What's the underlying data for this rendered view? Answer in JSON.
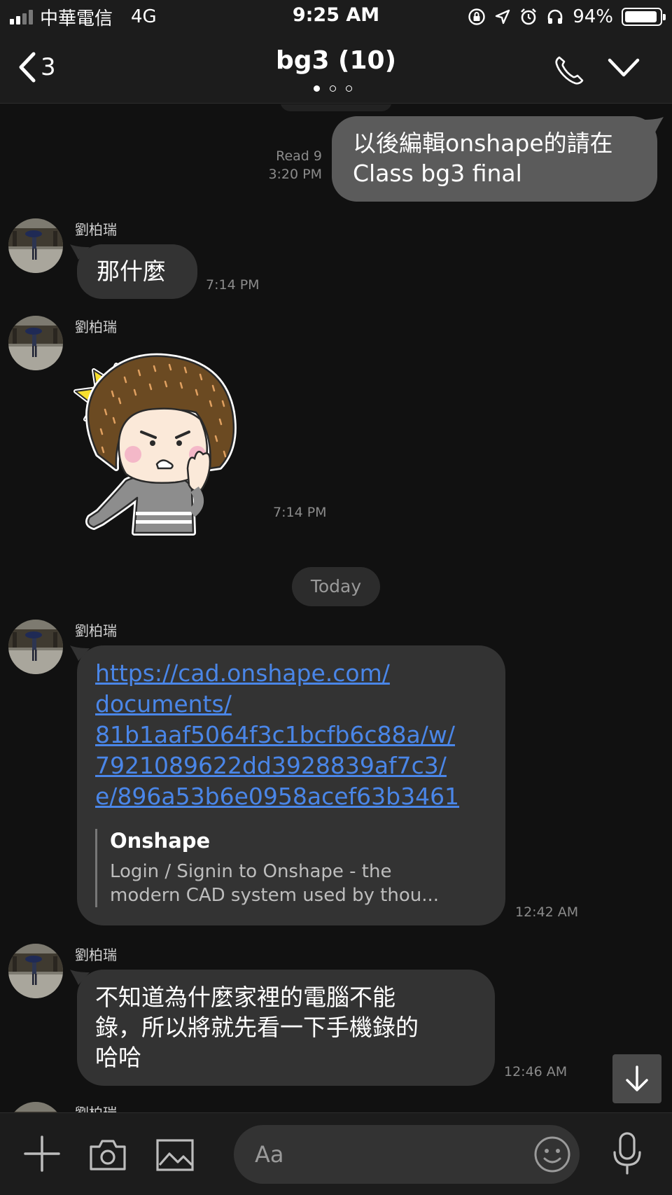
{
  "status_bar": {
    "carrier": "中華電信",
    "network": "4G",
    "time": "9:25 AM",
    "battery": "94%",
    "battery_level": 0.94
  },
  "header": {
    "back_count": "3",
    "title": "bg3 (10)",
    "page_dots": 3,
    "active_dot": 0
  },
  "messages": [
    {
      "from": "me",
      "text_line1": "以後編輯onshape的請在",
      "text_line2": "Class bg3 final",
      "read": "Read 9",
      "time": "3:20 PM"
    },
    {
      "from": "劉柏瑞",
      "text": "那什麼",
      "time": "7:14 PM"
    },
    {
      "from": "劉柏瑞",
      "type": "sticker",
      "sticker": "angry-girl-sticker",
      "time": "7:14 PM"
    },
    {
      "from": "劉柏瑞",
      "type": "link",
      "link_lines": [
        "https://cad.onshape.com/",
        "documents/",
        "81b1aaf5064f3c1bcfb6c88a/w/",
        "7921089622dd3928839af7c3/",
        "e/896a53b6e0958acef63b3461"
      ],
      "preview_title": "Onshape",
      "preview_desc_line1": "Login / Signin to Onshape - the",
      "preview_desc_line2": "modern CAD system used by thou...",
      "time": "12:42 AM"
    },
    {
      "from": "劉柏瑞",
      "text_lines": [
        "不知道為什麼家裡的電腦不能",
        "錄，所以將就先看一下手機錄的",
        "哈哈"
      ],
      "time": "12:46 AM"
    },
    {
      "from": "劉柏瑞"
    }
  ],
  "divider_today": "Today",
  "input": {
    "placeholder": "Aa"
  },
  "colors": {
    "background": "#111111",
    "bar": "#1c1c1c",
    "bubble_other": "#333333",
    "bubble_me": "#5b5b5b",
    "link": "#4a86e8"
  }
}
